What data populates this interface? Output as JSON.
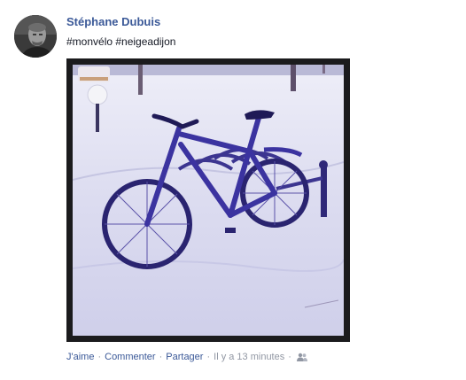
{
  "post": {
    "author_name": "Stéphane Dubuis",
    "message": "#monvélo #neigeadijon",
    "photo_icon": "snowy-bicycle-photo",
    "avatar_icon": "profile-photo"
  },
  "actions": {
    "like_label": "J'aime",
    "separator": "·",
    "comment_label": "Commenter",
    "share_label": "Partager",
    "timestamp": "Il y a 13 minutes",
    "audience_icon": "friends-icon"
  },
  "colors": {
    "link": "#3b5998",
    "muted": "#9197a3",
    "text": "#141823"
  }
}
